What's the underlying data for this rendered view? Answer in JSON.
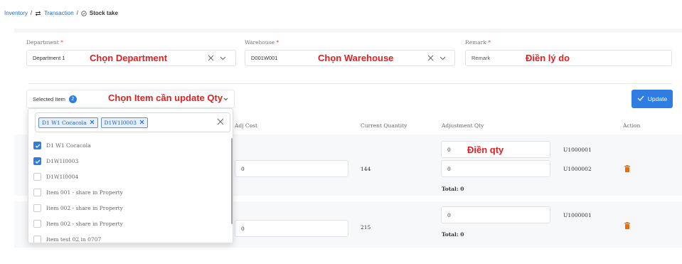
{
  "breadcrumb": {
    "inventory": "Inventory",
    "sep1": "/",
    "transaction": "Transaction",
    "sep2": "/",
    "stock_take": "Stock take"
  },
  "form": {
    "department": {
      "label": "Department",
      "required": "*",
      "value": "Department 1",
      "annotation": "Chọn Department"
    },
    "warehouse": {
      "label": "Warehouse",
      "required": "*",
      "value": "D001W001",
      "annotation": "Chọn Warehouse"
    },
    "remark": {
      "label": "Remark",
      "required": "*",
      "placeholder": "Remark",
      "annotation": "Điền lý do"
    }
  },
  "selected_item": {
    "label": "Selected Item",
    "count": "2",
    "annotation": "Chọn Item cần update Qty"
  },
  "update_button": {
    "label": "Update"
  },
  "table": {
    "headers": {
      "adj_cost": "Adj Cost",
      "current_quantity": "Current Quantity",
      "adjustment_qty": "Adjustment Qty",
      "action": "Action"
    },
    "rows": [
      {
        "adj_cost": "0",
        "current_quantity": "144",
        "adjustments": [
          {
            "value": "0",
            "unit": "U1000001"
          },
          {
            "value": "0",
            "unit": "U1000002"
          }
        ],
        "total": "Total: 0",
        "annotation": "Điền qty"
      },
      {
        "adj_cost": "0",
        "current_quantity": "215",
        "adjustments": [
          {
            "value": "0",
            "unit": "U1000001"
          }
        ],
        "total": "Total: 0"
      }
    ]
  },
  "dropdown": {
    "tags": [
      "D1 W1 Cocacola",
      "D1W1I0003"
    ],
    "options": [
      {
        "label": "D1 W1 Cocacola",
        "checked": true
      },
      {
        "label": "D1W1I0003",
        "checked": true
      },
      {
        "label": "D1W1I0004",
        "checked": false
      },
      {
        "label": "Item 001 - share in Property",
        "checked": false
      },
      {
        "label": "Item 002 - share in Property",
        "checked": false
      },
      {
        "label": "Item 002 - share in Property",
        "checked": false
      },
      {
        "label": "Item test 02 in 0707",
        "checked": false
      }
    ]
  },
  "colors": {
    "accent": "#2f7de1",
    "annotation": "#e02020",
    "delete": "#ef6c00"
  }
}
